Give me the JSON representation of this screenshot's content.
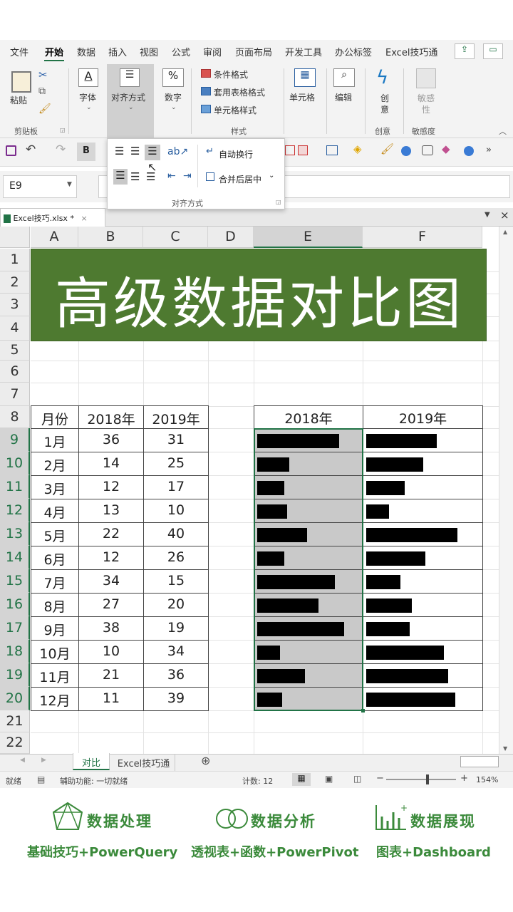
{
  "menu": {
    "items": [
      "文件",
      "开始",
      "数据",
      "插入",
      "视图",
      "公式",
      "审阅",
      "页面布局",
      "开发工具",
      "办公标签",
      "Excel技巧通"
    ],
    "active": "开始"
  },
  "ribbon": {
    "paste": "粘贴",
    "clipboard_group": "剪贴板",
    "font": "字体",
    "align": "对齐方式",
    "number": "数字",
    "cond_format": "条件格式",
    "table_format": "套用表格格式",
    "cell_style": "单元格样式",
    "styles_group": "样式",
    "cells": "单元格",
    "edit": "编辑",
    "creative": "创意",
    "creative_group": "创意",
    "sensitivity": "敏感性",
    "sensitivity_group": "敏感度"
  },
  "popup": {
    "wrap": "自动换行",
    "merge": "合并后居中",
    "group": "对齐方式"
  },
  "namebox": "E9",
  "file_tab": "Excel技巧.xlsx *",
  "columns": [
    "A",
    "B",
    "C",
    "D",
    "E",
    "F"
  ],
  "rows": [
    "1",
    "2",
    "3",
    "4",
    "5",
    "6",
    "7",
    "8",
    "9",
    "10",
    "11",
    "12",
    "13",
    "14",
    "15",
    "16",
    "17",
    "18",
    "19",
    "20",
    "21",
    "22"
  ],
  "banner_title": "高级数据对比图",
  "table": {
    "headers": [
      "月份",
      "2018年",
      "2019年"
    ],
    "rows": [
      [
        "1月",
        "36",
        "31"
      ],
      [
        "2月",
        "14",
        "25"
      ],
      [
        "3月",
        "12",
        "17"
      ],
      [
        "4月",
        "13",
        "10"
      ],
      [
        "5月",
        "22",
        "40"
      ],
      [
        "6月",
        "12",
        "26"
      ],
      [
        "7月",
        "34",
        "15"
      ],
      [
        "8月",
        "27",
        "20"
      ],
      [
        "9月",
        "38",
        "19"
      ],
      [
        "10月",
        "10",
        "34"
      ],
      [
        "11月",
        "21",
        "36"
      ],
      [
        "12月",
        "11",
        "39"
      ]
    ]
  },
  "bar_table": {
    "headers": [
      "2018年",
      "2019年"
    ]
  },
  "chart_data": {
    "type": "bar",
    "categories": [
      "1月",
      "2月",
      "3月",
      "4月",
      "5月",
      "6月",
      "7月",
      "8月",
      "9月",
      "10月",
      "11月",
      "12月"
    ],
    "series": [
      {
        "name": "2018年",
        "values": [
          36,
          14,
          12,
          13,
          22,
          12,
          34,
          27,
          38,
          10,
          21,
          11
        ]
      },
      {
        "name": "2019年",
        "values": [
          31,
          25,
          17,
          10,
          40,
          26,
          15,
          20,
          19,
          34,
          36,
          39
        ]
      }
    ],
    "max": 40
  },
  "sheets": {
    "tabs": [
      "对比",
      "Excel技巧通"
    ],
    "active": "对比"
  },
  "status": {
    "ready": "就绪",
    "accessibility": "辅助功能: 一切就绪",
    "count": "计数: 12",
    "zoom": "154%"
  },
  "promo": {
    "items": [
      {
        "title": "数据处理",
        "sub": "基础技巧+PowerQuery"
      },
      {
        "title": "数据分析",
        "sub": "透视表+函数+PowerPivot"
      },
      {
        "title": "数据展现",
        "sub": "图表+Dashboard"
      }
    ]
  },
  "colors": {
    "banner": "#4e7a30",
    "accent": "#217346",
    "promo": "#3b8a3b"
  }
}
